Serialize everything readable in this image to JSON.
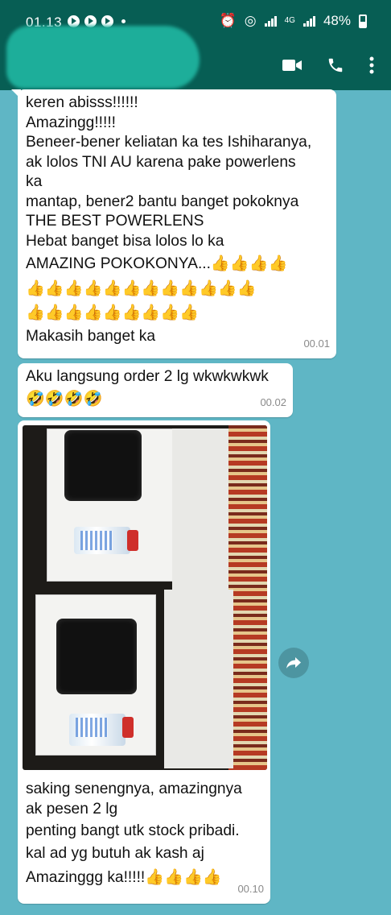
{
  "status_bar": {
    "time": "01.13",
    "network": "4G",
    "battery": "48%"
  },
  "app_bar": {
    "contact_name": "",
    "icons": [
      "video-call-icon",
      "phone-call-icon",
      "more-options-icon"
    ]
  },
  "messages": [
    {
      "lines": [
        "keren abisss!!!!!!",
        "Amazingg!!!!!",
        "Beneer-bener keliatan ka tes Ishiharanya,",
        "ak lolos TNI AU karena pake powerlens",
        "ka",
        "mantap, bener2 bantu banget pokoknya",
        "THE BEST POWERLENS",
        "Hebat banget bisa lolos lo ka",
        "AMAZING POKOKONYA...👍👍👍👍",
        "👍👍👍👍👍👍👍👍👍👍👍👍",
        "👍👍👍👍👍👍👍👍👍",
        "Makasih banget ka"
      ],
      "time": "00.01"
    },
    {
      "lines": [
        "Aku langsung order 2 lg wkwkwkwk",
        "🤣🤣🤣🤣"
      ],
      "time": "00.02"
    },
    {
      "lines": [
        "saking senengnya, amazingnya",
        "ak pesen 2 lg",
        "penting bangt utk stock pribadi.",
        "kal ad yg butuh ak kash aj",
        "Amazinggg ka!!!!!👍👍👍👍"
      ],
      "time": "00.10",
      "photo": "photo-two-boxed-devices"
    }
  ],
  "colors": {
    "header": "#075e54",
    "chat_background": "#5fb6c5",
    "bubble": "#ffffff",
    "timestamp": "#8a8a8a"
  }
}
